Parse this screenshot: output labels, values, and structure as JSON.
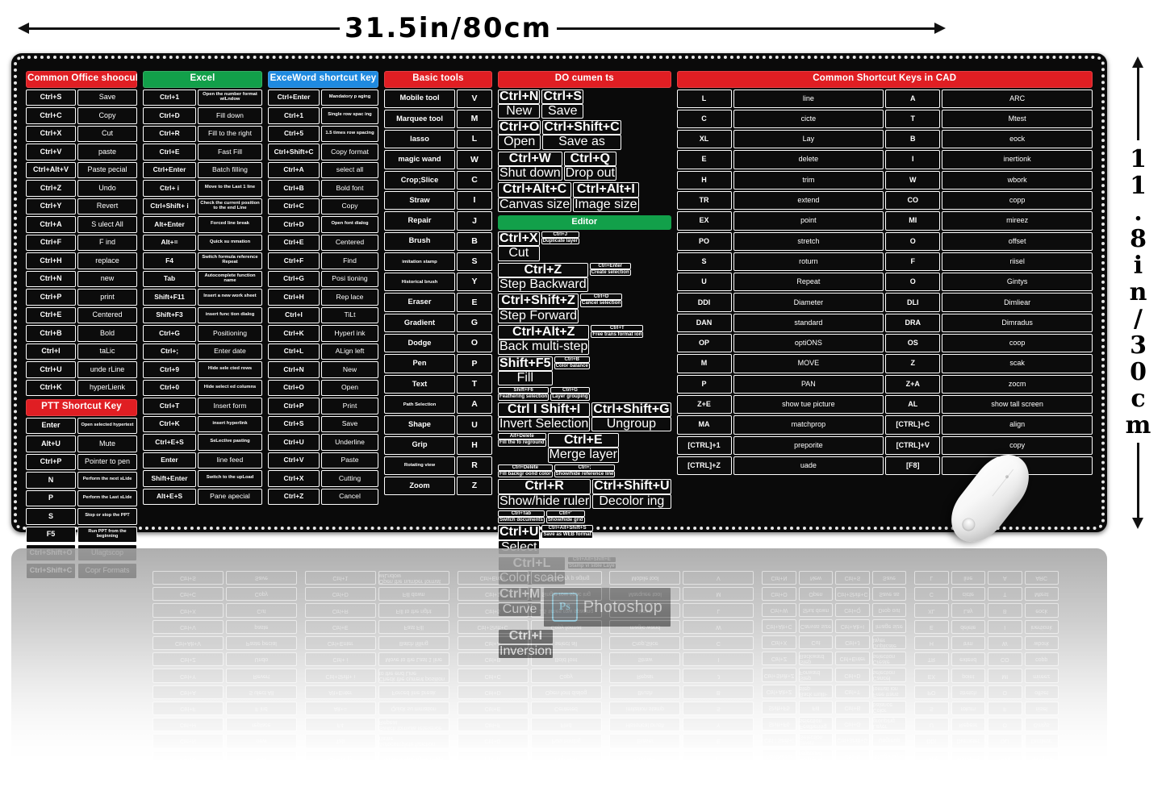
{
  "dimensions": {
    "width_label": "31.5in/80cm",
    "height_label": "11.8in/30cm"
  },
  "brand": {
    "photoshop_badge": "Ps",
    "photoshop_name": "Photoshop"
  },
  "blocks": [
    {
      "id": "office",
      "header": "Common Office shoocuLs",
      "header_color": "#e01e23",
      "rows": [
        [
          "Ctrl+S",
          "Save"
        ],
        [
          "Ctrl+C",
          "Copy"
        ],
        [
          "Ctrl+X",
          "Cut"
        ],
        [
          "Ctrl+V",
          "paste"
        ],
        [
          "Ctrl+Alt+V",
          "Paste pecial"
        ],
        [
          "Ctrl+Z",
          "Undo"
        ],
        [
          "Ctrl+Y",
          "Revert"
        ],
        [
          "Ctrl+A",
          "S ulect All"
        ],
        [
          "Ctrl+F",
          "F ind"
        ],
        [
          "Ctrl+H",
          "replace"
        ],
        [
          "Ctrl+N",
          "new"
        ],
        [
          "Ctrl+P",
          "print"
        ],
        [
          "Ctrl+E",
          "Centered"
        ],
        [
          "Ctrl+B",
          "Bold"
        ],
        [
          "Ctrl+I",
          "taLic"
        ],
        [
          "Ctrl+U",
          "unde rLine"
        ],
        [
          "Ctrl+K",
          "hyperLienk"
        ]
      ],
      "subsection": {
        "header": "PTT Shortcut Key",
        "header_color": "#e01e23",
        "rows": [
          [
            "Enter",
            "Open selected hypertext",
            true
          ],
          [
            "Alt+U",
            "Mute"
          ],
          [
            "Ctrl+P",
            "Pointer to pen"
          ],
          [
            "N",
            "Perform the next sLide",
            true
          ],
          [
            "P",
            "Perform the Last sLide",
            true
          ],
          [
            "S",
            "Stop or stop the PPT",
            true
          ],
          [
            "F5",
            "Run PPT from the beginning",
            true
          ],
          [
            "Ctrl+Shift+O",
            "Ulagtscop"
          ],
          [
            "Ctrl+Shift+C",
            "Copr Formats"
          ]
        ]
      }
    },
    {
      "id": "excel",
      "header": "Excel",
      "header_color": "#12a04a",
      "rows": [
        [
          "Ctrl+1",
          "Open the number format wiLndow",
          true
        ],
        [
          "Ctrl+D",
          "Fill down"
        ],
        [
          "Ctrl+R",
          "Fill to the right"
        ],
        [
          "Ctrl+E",
          "Fast Fill"
        ],
        [
          "Ctrl+Enter",
          "Batch filling"
        ],
        [
          "Ctrl+ i",
          "Move to the Last 1 line",
          true
        ],
        [
          "Ctrl+Shift+ i",
          "Check the current position to the end Line",
          true
        ],
        [
          "Alt+Enter",
          "Forced line break",
          true
        ],
        [
          "Alt+=",
          "Quick su mmation",
          true
        ],
        [
          "F4",
          "Switch formula reference Repeat",
          true
        ],
        [
          "Tab",
          "Autocomplete function name",
          true
        ],
        [
          "Shift+F11",
          "Insert a new work sheet",
          true
        ],
        [
          "Shift+F3",
          "insert func tion dialog",
          true
        ],
        [
          "Ctrl+G",
          "Positioning"
        ],
        [
          "Ctrl+;",
          "Enter date"
        ],
        [
          "Ctrl+9",
          "Hide sele cted rows",
          true
        ],
        [
          "Ctrl+0",
          "Hide select ed columns",
          true
        ],
        [
          "Ctrl+T",
          "Insert form"
        ],
        [
          "Ctrl+K",
          "insert hyperlink",
          true
        ],
        [
          "Ctrl+E+S",
          "SeLective pasting",
          true
        ],
        [
          "Enter",
          "line feed"
        ],
        [
          "Shift+Enter",
          "Switch to the upLoad",
          true
        ],
        [
          "Alt+E+S",
          "Pane apecial"
        ]
      ]
    },
    {
      "id": "word",
      "header": "ExceWord shortcut key",
      "header_color": "#1f8ae0",
      "rows": [
        [
          "Ctrl+Enter",
          "Mandatory p aging",
          true
        ],
        [
          "Ctrl+1",
          "Single row spac ing",
          true
        ],
        [
          "Ctrl+5",
          "1.5 times row spacing",
          true
        ],
        [
          "Ctrl+Shift+C",
          "Copy format"
        ],
        [
          "Ctrl+A",
          "select all"
        ],
        [
          "Ctrl+B",
          "Bold font"
        ],
        [
          "Ctrl+C",
          "Copy"
        ],
        [
          "Ctrl+D",
          "Open font dialog",
          true
        ],
        [
          "Ctrl+E",
          "Centered"
        ],
        [
          "Ctrl+F",
          "Find"
        ],
        [
          "Ctrl+G",
          "Posi tioning"
        ],
        [
          "Ctrl+H",
          "Rep lace"
        ],
        [
          "Ctrl+I",
          "TiLt"
        ],
        [
          "Ctrl+K",
          "Hyperl ink"
        ],
        [
          "Ctrl+L",
          "ALign left"
        ],
        [
          "Ctrl+N",
          "New"
        ],
        [
          "Ctrl+O",
          "Open"
        ],
        [
          "Ctrl+P",
          "Print"
        ],
        [
          "Ctrl+S",
          "Save"
        ],
        [
          "Ctrl+U",
          "Underline"
        ],
        [
          "Ctrl+V",
          "Paste"
        ],
        [
          "Ctrl+X",
          "Cutting"
        ],
        [
          "Ctrl+Z",
          "Cancel"
        ]
      ]
    },
    {
      "id": "tools",
      "header": "Basic tools",
      "header_color": "#e01e23",
      "rows": [
        [
          "Mobile tool",
          "V"
        ],
        [
          "Marquee tool",
          "M"
        ],
        [
          "lasso",
          "L"
        ],
        [
          "magic wand",
          "W"
        ],
        [
          "Crop;Slice",
          "C"
        ],
        [
          "Straw",
          "I"
        ],
        [
          "Repair",
          "J"
        ],
        [
          "Brush",
          "B"
        ],
        [
          "imitation stamp",
          "S",
          true
        ],
        [
          "Historical brush",
          "Y",
          true
        ],
        [
          "Eraser",
          "E"
        ],
        [
          "Gradient",
          "G"
        ],
        [
          "Dodge",
          "O"
        ],
        [
          "Pen",
          "P"
        ],
        [
          "Text",
          "T"
        ],
        [
          "Path Selection",
          "A",
          true
        ],
        [
          "Shape",
          "U"
        ],
        [
          "Grip",
          "H"
        ],
        [
          "Rotating view",
          "R",
          true
        ],
        [
          "Zoom",
          "Z"
        ]
      ]
    },
    {
      "id": "documents",
      "header": "DO cumen ts",
      "header_color": "#e01e23",
      "rows": [
        [
          "Ctrl+N",
          "New",
          "Ctrl+S",
          "Save"
        ],
        [
          "Ctrl+O",
          "Open",
          "Ctrl+Shift+C",
          "Save as"
        ],
        [
          "Ctrl+W",
          "Shut down",
          "Ctrl+Q",
          "Drop out"
        ],
        [
          "Ctrl+Alt+C",
          "Canvas size",
          "Ctrl+Alt+I",
          "Image size"
        ]
      ],
      "subsection": {
        "header": "Editor",
        "header_color": "#12a04a",
        "rows": [
          [
            "Ctrl+X",
            "Cut",
            "Ctrl+J",
            "Duplicate layer",
            false,
            true
          ],
          [
            "Ctrl+Z",
            "Step Backward",
            "Ctrl+Enter",
            "Create selection",
            false,
            true
          ],
          [
            "Ctrl+Shift+Z",
            "Step Forward",
            "Ctrl+D",
            "Cancel selection",
            false,
            true
          ],
          [
            "Ctrl+Alt+Z",
            "Back multi-step",
            "Ctrl+T",
            "Free trans format ion",
            false,
            true
          ],
          [
            "Shift+F5",
            "Fill",
            "Ctrl+B",
            "Color balance",
            false,
            true
          ],
          [
            "Shift+F6",
            "Feathering selection",
            "Ctrl+G",
            "Layer grouping",
            true,
            true
          ],
          [
            "Ctrl I Shift+I",
            "Invert Selection",
            "Ctrl+Shift+G",
            "Ungroup",
            false,
            false
          ],
          [
            "Alt+Delete",
            "Fill the fo reground",
            "Ctrl+E",
            "Merge layer",
            true,
            false
          ],
          [
            "Ctrl+Delete",
            "Fill backgr oond color",
            "Ctrl+;",
            "Show/hide reference line",
            true,
            true
          ],
          [
            "Ctrl+R",
            "Show/hide ruler",
            "Ctrl+Shift+U",
            "Decolor ing",
            false,
            false
          ],
          [
            "Ctrl+Tab",
            "Switch documents",
            "Ctrl+'",
            "Show/hide grid",
            true,
            true
          ],
          [
            "Ctrl+U",
            "Select",
            "Ctrl+Alt+Shift+S",
            "Save as WEB format",
            false,
            true
          ],
          [
            "Ctrl+L",
            "Color scale",
            "Ctrl+Alt+Shift+E",
            "Stamp vi sible Laye",
            false,
            true
          ],
          [
            "Ctrl+M",
            "Curve",
            "PS_LOGO",
            "",
            false,
            false
          ],
          [
            "Ctrl+I",
            "Inversion",
            "",
            "",
            false,
            false
          ]
        ]
      }
    },
    {
      "id": "cad",
      "header": "Common Shortcut Keys in CAD",
      "header_color": "#e01e23",
      "rows": [
        [
          "L",
          "line",
          "A",
          "ARC"
        ],
        [
          "C",
          "cicte",
          "T",
          "Mtest"
        ],
        [
          "XL",
          "Lay",
          "B",
          "eock"
        ],
        [
          "E",
          "delete",
          "I",
          "inertionk"
        ],
        [
          "H",
          "trim",
          "W",
          "wbork"
        ],
        [
          "TR",
          "extend",
          "CO",
          "copp"
        ],
        [
          "EX",
          "point",
          "MI",
          "mireez"
        ],
        [
          "PO",
          "stretch",
          "O",
          "offset"
        ],
        [
          "S",
          "roturn",
          "F",
          "riisel"
        ],
        [
          "U",
          "Repeat",
          "O",
          "Gintys"
        ],
        [
          "DDI",
          "Diameter",
          "DLI",
          "Dimliear"
        ],
        [
          "DAN",
          "standard",
          "DRA",
          "Dimradus"
        ],
        [
          "OP",
          "optiONS",
          "OS",
          "coop"
        ],
        [
          "M",
          "MOVE",
          "Z",
          "scak"
        ],
        [
          "P",
          "PAN",
          "Z+A",
          "zocm"
        ],
        [
          "Z+E",
          "show tue picture",
          "AL",
          "show tall screen"
        ],
        [
          "MA",
          "matchprop",
          "[CTRL]+C",
          "align"
        ],
        [
          "[CTRL]+1",
          "preporite",
          "[CTRL]+V",
          "copy"
        ],
        [
          "[CTRL]+Z",
          "uade",
          "[F8]",
          "ortho"
        ]
      ]
    }
  ]
}
